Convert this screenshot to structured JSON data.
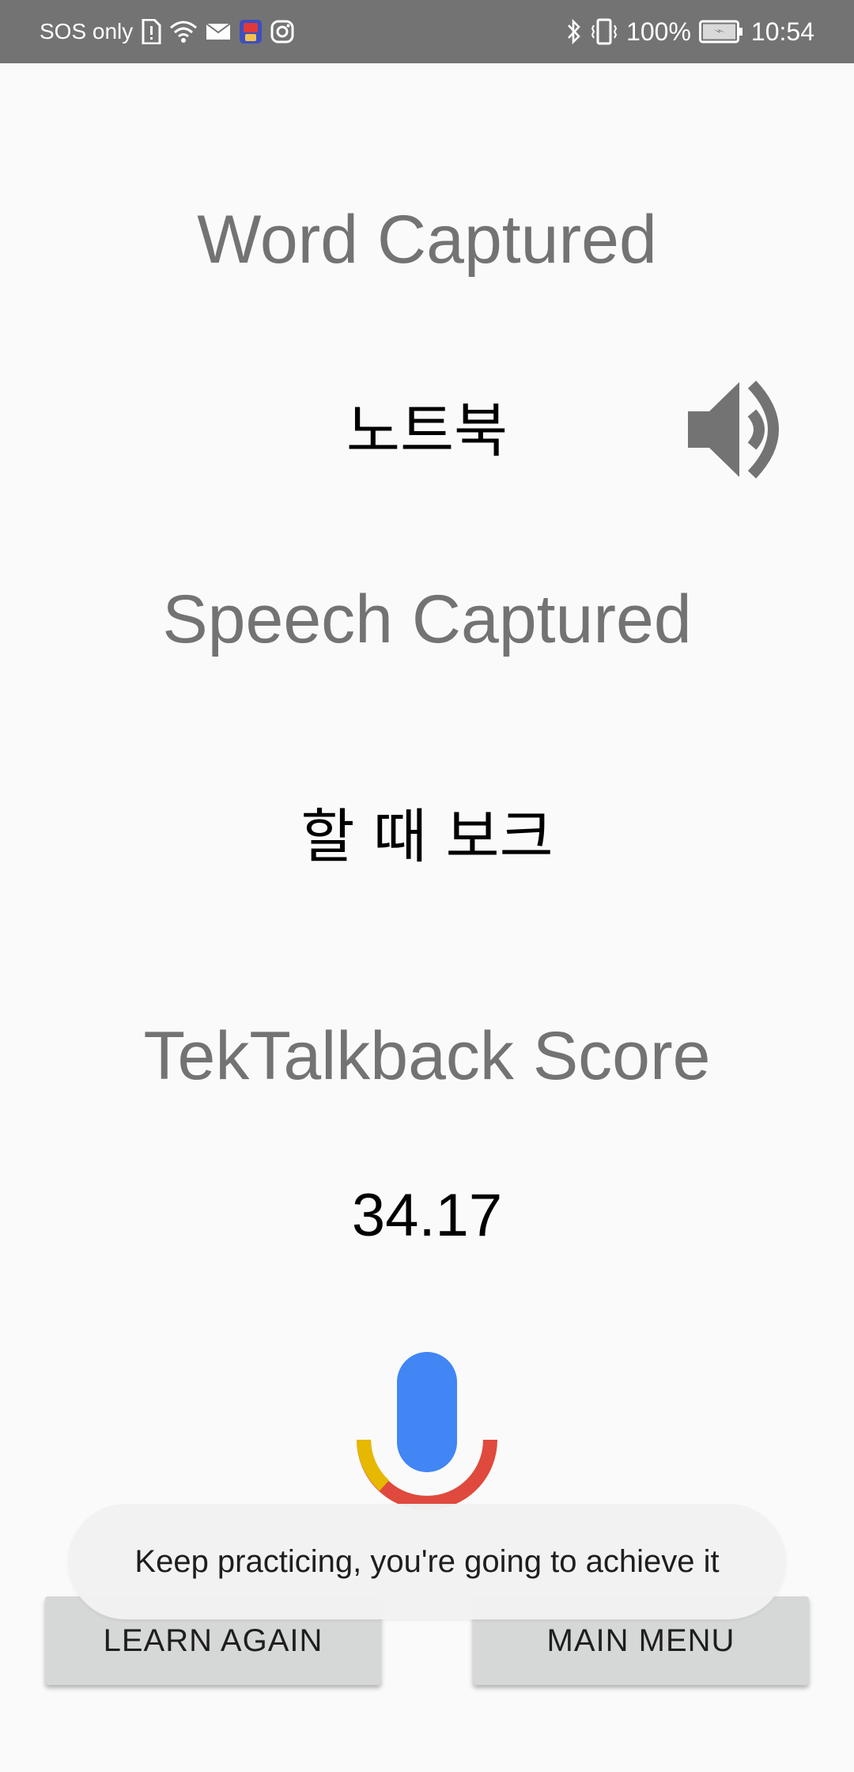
{
  "status_bar": {
    "carrier": "SOS only",
    "battery": "100%",
    "time": "10:54",
    "left_icons": [
      "sim-alert-icon",
      "wifi-icon",
      "mail-icon",
      "app-notification-icon",
      "instagram-icon"
    ],
    "right_icons": [
      "bluetooth-icon",
      "vibrate-icon",
      "battery-charging-icon"
    ],
    "background": "#737373"
  },
  "word_section": {
    "heading": "Word Captured",
    "word": "노트북",
    "speaker_icon": "speaker-icon"
  },
  "speech_section": {
    "heading": "Speech Captured",
    "speech": "할 때 보크"
  },
  "score_section": {
    "heading": "TekTalkback Score",
    "score": "34.17"
  },
  "mic": {
    "icon": "microphone-icon",
    "colors": {
      "body": "#4285f4",
      "arc_red": "#e0493d",
      "arc_yellow": "#e6b800",
      "stem": "#d9ebe3"
    }
  },
  "buttons": {
    "learn_again": "LEARN AGAIN",
    "main_menu": "MAIN MENU"
  },
  "toast": {
    "message": "Keep practicing, you're going to achieve it"
  },
  "colors": {
    "heading": "#737373",
    "value": "#000000",
    "button_bg": "#d6d7d7",
    "background": "#fafafa"
  }
}
